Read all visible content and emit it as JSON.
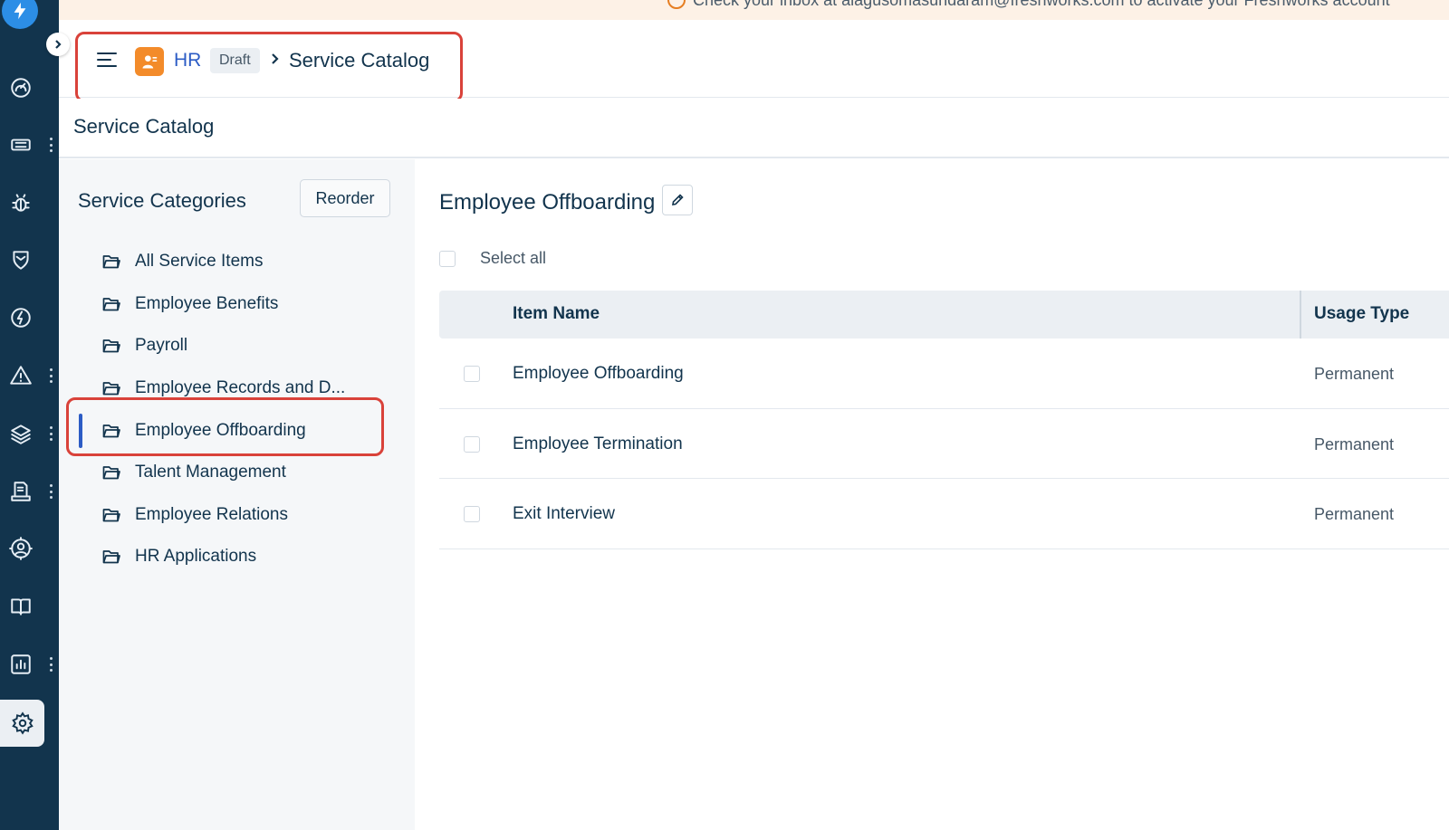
{
  "banner": {
    "text": "Check your inbox at alagusomasundaram@freshworks.com to activate your Freshworks account"
  },
  "header": {
    "module_name": "HR",
    "status_badge": "Draft",
    "breadcrumb_current": "Service Catalog"
  },
  "subheader": {
    "title": "Service Catalog"
  },
  "categories": {
    "heading": "Service Categories",
    "reorder_label": "Reorder",
    "items": [
      {
        "label": "All Service Items"
      },
      {
        "label": "Employee Benefits"
      },
      {
        "label": "Payroll"
      },
      {
        "label": "Employee Records and D..."
      },
      {
        "label": "Employee Offboarding"
      },
      {
        "label": "Talent Management"
      },
      {
        "label": "Employee Relations"
      },
      {
        "label": "HR Applications"
      }
    ],
    "active_index": 4
  },
  "main": {
    "title": "Employee Offboarding",
    "select_all_label": "Select all",
    "columns": {
      "item_name": "Item Name",
      "usage_type": "Usage Type"
    },
    "rows": [
      {
        "name": "Employee Offboarding",
        "usage": "Permanent"
      },
      {
        "name": "Employee Termination",
        "usage": "Permanent"
      },
      {
        "name": "Exit Interview",
        "usage": "Permanent"
      }
    ]
  },
  "icons": {
    "rail": [
      "logo-bolt-icon",
      "dashboard-icon",
      "ticket-icon",
      "bug-icon",
      "shield-icon",
      "change-icon",
      "alert-icon",
      "layers-icon",
      "document-icon",
      "user-circle-icon",
      "book-icon",
      "reports-icon",
      "settings-icon"
    ]
  },
  "colors": {
    "rail_bg": "#12344d",
    "accent_blue": "#2c5cc5",
    "hr_orange": "#f38b2a",
    "annotation_red": "#d9423a",
    "banner_bg": "#fdf1e6"
  }
}
